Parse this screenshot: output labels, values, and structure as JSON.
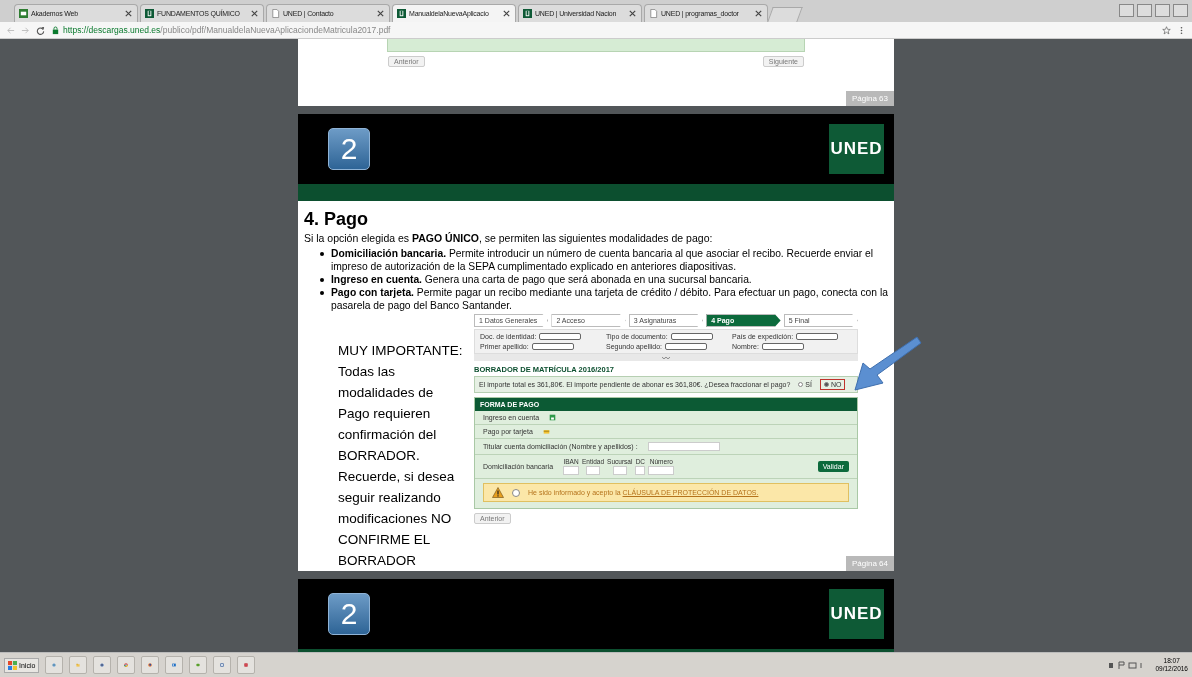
{
  "browser": {
    "tabs": [
      {
        "title": "Akademos Web",
        "selected": false
      },
      {
        "title": "FUNDAMENTOS QUÍMICO",
        "selected": false
      },
      {
        "title": "UNED | Contacto",
        "selected": false
      },
      {
        "title": "ManualdelaNuevaAplicacio",
        "selected": true
      },
      {
        "title": "UNED | Universidad Nacion",
        "selected": false
      },
      {
        "title": "UNED | programas_doctor",
        "selected": false
      }
    ],
    "url_host": "https://descargas.uned.es",
    "url_path": "/publico/pdf/ManualdelaNuevaAplicaciondeMatricula2017.pdf"
  },
  "pdf": {
    "pages": [
      {
        "kind": "form_end",
        "buttons": [
          "Anterior",
          "Siguiente"
        ],
        "page_label": "Página 63"
      },
      {
        "kind": "slide",
        "number": "2",
        "logo": "UNED",
        "heading": "4. Pago",
        "intro": "Si la opción elegida es **PAGO ÚNICO**, se permiten las siguientes modalidades de pago:",
        "bullets": [
          "**Domiciliación bancaria.** Permite introducir un número de cuenta bancaria al que asociar el recibo. Recuerde enviar el impreso de autorización de la SEPA cumplimentado explicado en anteriores diapositivas.",
          "**Ingreso en cuenta.** Genera una carta de pago que será abonada en una sucursal bancaria.",
          "**Pago con tarjeta.** Permite pagar un recibo mediante una tarjeta de crédito / débito. Para efectuar un pago, conecta con la pasarela de pago del Banco Santander."
        ],
        "note": "MUY IMPORTANTE: Todas las modalidades de Pago requieren confirmación del BORRADOR. Recuerde, si desea seguir realizando modificaciones NO CONFIRME EL BORRADOR",
        "form": {
          "steps": [
            {
              "label": "1  Datos Generales",
              "selected": false
            },
            {
              "label": "2  Acceso",
              "selected": false
            },
            {
              "label": "3  Asignaturas",
              "selected": false
            },
            {
              "label": "4  Pago",
              "selected": true
            },
            {
              "label": "5  Final",
              "selected": false
            }
          ],
          "id_fields": [
            "Doc. de identidad:",
            "Tipo de documento:",
            "País de expedición:",
            "Primer apellido:",
            "Segundo apellido:",
            "Nombre:"
          ],
          "title": "BORRADOR DE MATRÍCULA 2016/2017",
          "total_text": "El importe total es 361,80€. El importe pendiente de abonar es 361,80€. ¿Desea fraccionar el pago?",
          "options": [
            {
              "label": "SÍ",
              "selected": false
            },
            {
              "label": "NO",
              "selected": true
            }
          ],
          "section": "FORMA DE PAGO",
          "methods": [
            "Ingreso en cuenta",
            "Pago por tarjeta"
          ],
          "holder_label": "Titular cuenta domiciliación (Nombre y apellidos) :",
          "bank_label": "Domiciliación bancaria",
          "bank_parts": [
            "IBAN",
            "Entidad",
            "Sucursal",
            "DC",
            "Número"
          ],
          "validate": "Validar",
          "clause_checked": false,
          "clause": "He sido informado y acepto la",
          "clause_link": "CLÁUSULA DE PROTECCIÓN DE DATOS.",
          "back": "Anterior"
        },
        "page_label": "Página 64"
      },
      {
        "kind": "slide_header",
        "number": "2",
        "logo": "UNED"
      }
    ]
  },
  "taskbar": {
    "start": "Inicio",
    "time": "18:07",
    "date": "09/12/2016"
  }
}
